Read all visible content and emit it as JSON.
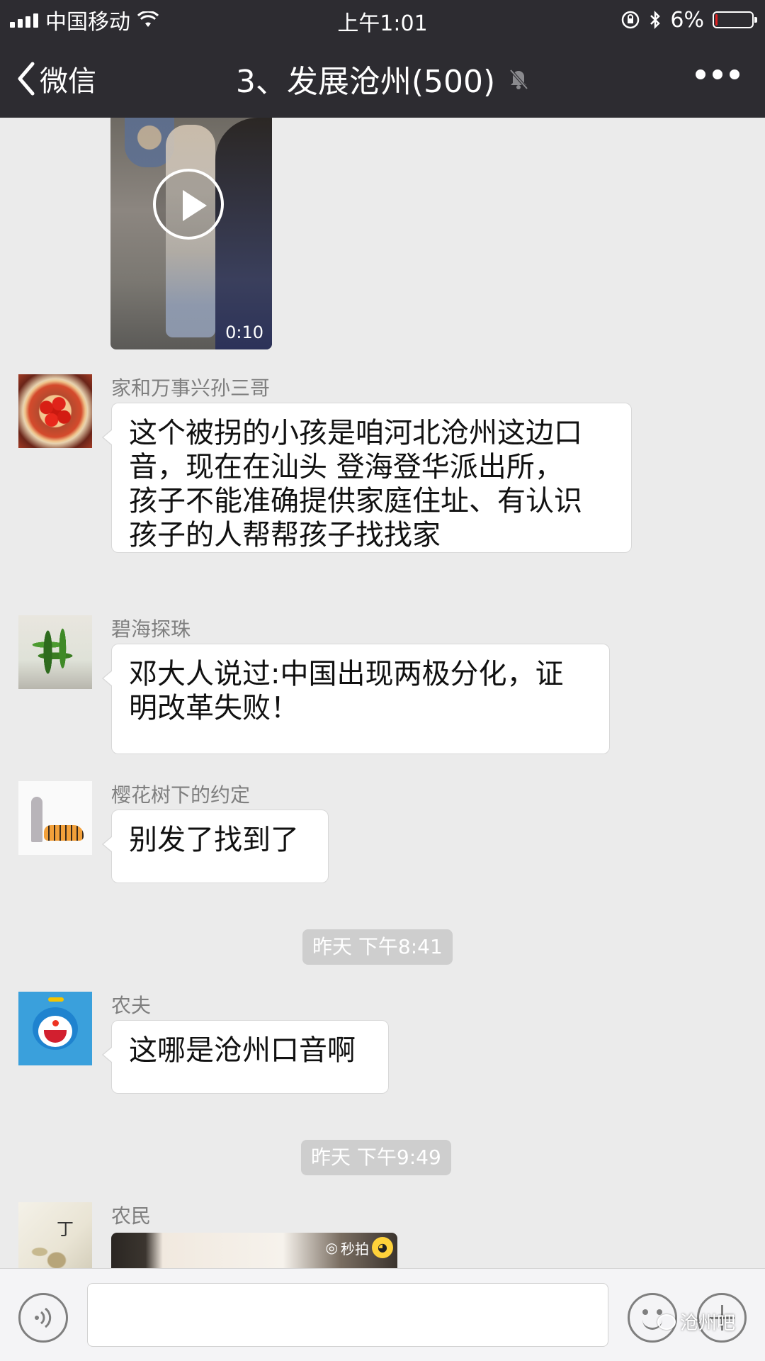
{
  "status_bar": {
    "carrier": "中国移动",
    "time": "上午1:01",
    "battery_percent": "6%",
    "battery_level": 0.06,
    "battery_color": "#e02020"
  },
  "nav": {
    "back_label": "微信",
    "title": "3、发展沧州(500)",
    "icons": [
      "chevron-left-icon",
      "mute-bell-icon",
      "more-icon"
    ]
  },
  "messages": {
    "video_top": {
      "duration": "0:10"
    },
    "m1": {
      "sender": "家和万事兴孙三哥",
      "lines": [
        "这个被拐的小孩是咱河北沧州这边口",
        "音，现在在汕头 登海登华派出所，",
        "孩子不能准确提供家庭住址、有认识",
        "孩子的人帮帮孩子找找家"
      ]
    },
    "m2": {
      "sender": "碧海探珠",
      "lines": [
        "邓大人说过:中国出现两极分化，证",
        "明改革失败！"
      ]
    },
    "m3": {
      "sender": "樱花树下的约定",
      "lines": [
        "别发了找到了"
      ]
    },
    "ts1": "昨天 下午8:41",
    "m4": {
      "sender": "农夫",
      "lines": [
        "这哪是沧州口音啊"
      ]
    },
    "ts2": "昨天 下午9:49",
    "m5": {
      "sender": "农民",
      "avatar_char": "丁",
      "video_logo": "秒拍"
    }
  },
  "input_bar": {
    "placeholder": "",
    "icons": [
      "voice-icon",
      "emoji-icon",
      "plus-icon"
    ]
  },
  "watermark": "沧州吧",
  "colors": {
    "nav_bg": "#2d2c31",
    "chat_bg": "#ebebeb",
    "bubble_bg": "#ffffff",
    "timestamp_bg": "#cecece"
  }
}
